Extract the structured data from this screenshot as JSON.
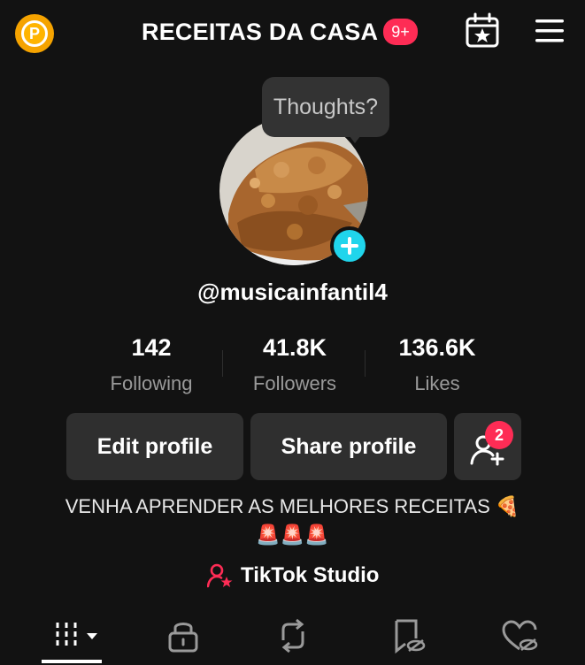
{
  "header": {
    "title": "RECEITAS DA CASA",
    "notification_badge": "9+",
    "coin_letter": "P"
  },
  "profile": {
    "thought_bubble": "Thoughts?",
    "username": "@musicainfantil4"
  },
  "stats": [
    {
      "value": "142",
      "label": "Following"
    },
    {
      "value": "41.8K",
      "label": "Followers"
    },
    {
      "value": "136.6K",
      "label": "Likes"
    }
  ],
  "actions": {
    "edit_profile": "Edit profile",
    "share_profile": "Share profile",
    "add_friends_badge": "2"
  },
  "bio": {
    "line1": "VENHA APRENDER AS MELHORES RECEITAS 🍕",
    "line2": "🚨🚨🚨"
  },
  "studio": {
    "label": "TikTok Studio"
  },
  "tabs": [
    {
      "icon": "grid-icon",
      "active": true
    },
    {
      "icon": "lock-icon"
    },
    {
      "icon": "repost-icon"
    },
    {
      "icon": "bookmark-eye-icon"
    },
    {
      "icon": "heart-eye-icon"
    }
  ],
  "colors": {
    "background": "#121212",
    "accent_red": "#fe2c55",
    "accent_cyan": "#20d5ec",
    "coin": "#f5a300",
    "button_bg": "#2f2f2f"
  }
}
